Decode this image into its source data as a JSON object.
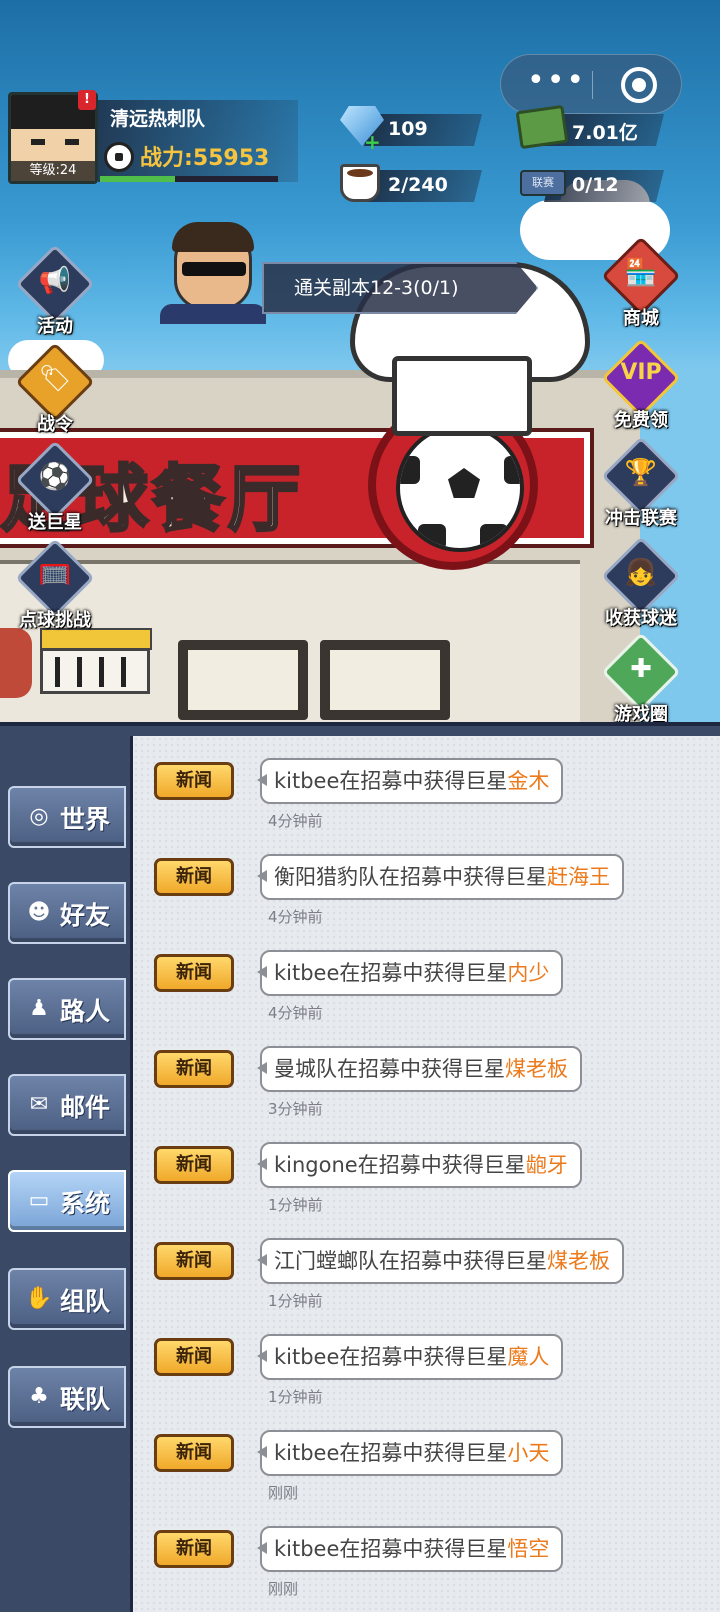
{
  "hud": {
    "team_name": "清远热刺队",
    "level_label": "等级:24",
    "alert_badge": "!",
    "power_label": "战力:",
    "power_value": "55953",
    "xp_fraction": 0.42
  },
  "resources": {
    "gems": "109",
    "cash": "7.01亿",
    "coffee": "2/240",
    "tickets": "0/12",
    "ticket_label": "联赛"
  },
  "capsule": {
    "more": "•••"
  },
  "quest": {
    "text": "通关副本12-3(0/1)"
  },
  "scene": {
    "banner": "足球餐厅"
  },
  "left_buttons": [
    {
      "label": "活动",
      "icon": "megaphone-icon"
    },
    {
      "label": "战令",
      "icon": "battle-pass-icon"
    },
    {
      "label": "送巨星",
      "icon": "star-player-icon"
    },
    {
      "label": "点球挑战",
      "icon": "penalty-icon"
    }
  ],
  "right_buttons": [
    {
      "label": "商城",
      "icon": "shop-icon"
    },
    {
      "label": "免费领",
      "icon": "vip-icon",
      "badge": "VIP"
    },
    {
      "label": "冲击联赛",
      "icon": "league-icon"
    },
    {
      "label": "收获球迷",
      "icon": "fans-icon"
    },
    {
      "label": "游戏圈",
      "icon": "game-circle-icon"
    }
  ],
  "tabs": [
    {
      "label": "世界",
      "icon": "planet-icon",
      "active": false
    },
    {
      "label": "好友",
      "icon": "friend-icon",
      "active": false
    },
    {
      "label": "路人",
      "icon": "stranger-icon",
      "active": false
    },
    {
      "label": "邮件",
      "icon": "mail-icon",
      "active": false
    },
    {
      "label": "系统",
      "icon": "monitor-icon",
      "active": true
    },
    {
      "label": "组队",
      "icon": "handshake-icon",
      "active": false
    },
    {
      "label": "联队",
      "icon": "group-icon",
      "active": false
    }
  ],
  "messages": [
    {
      "tag": "新闻",
      "prefix": "kitbee在招募中获得巨星",
      "star": "金木",
      "time": "4分钟前"
    },
    {
      "tag": "新闻",
      "prefix": "衡阳猎豹队在招募中获得巨星",
      "star": "赶海王",
      "time": "4分钟前"
    },
    {
      "tag": "新闻",
      "prefix": "kitbee在招募中获得巨星",
      "star": "内少",
      "time": "4分钟前"
    },
    {
      "tag": "新闻",
      "prefix": "曼城队在招募中获得巨星",
      "star": "煤老板",
      "time": "3分钟前"
    },
    {
      "tag": "新闻",
      "prefix": "kingone在招募中获得巨星",
      "star": "龅牙",
      "time": "1分钟前"
    },
    {
      "tag": "新闻",
      "prefix": "江门螳螂队在招募中获得巨星",
      "star": "煤老板",
      "time": "1分钟前"
    },
    {
      "tag": "新闻",
      "prefix": "kitbee在招募中获得巨星",
      "star": "魔人",
      "time": "1分钟前"
    },
    {
      "tag": "新闻",
      "prefix": "kitbee在招募中获得巨星",
      "star": "小天",
      "time": "刚刚"
    },
    {
      "tag": "新闻",
      "prefix": "kitbee在招募中获得巨星",
      "star": "悟空",
      "time": "刚刚"
    }
  ]
}
